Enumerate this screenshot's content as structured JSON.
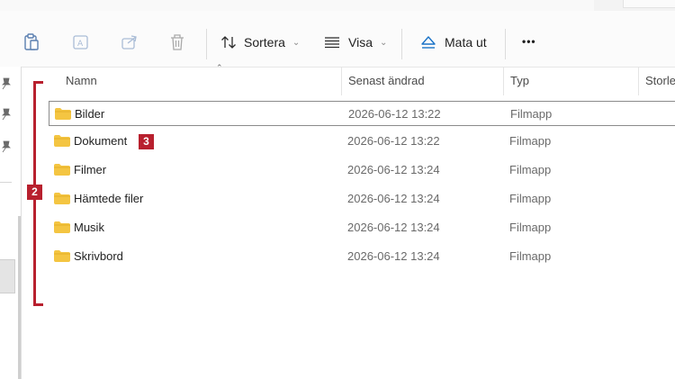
{
  "toolbar": {
    "sort_label": "Sortera",
    "view_label": "Visa",
    "eject_label": "Mata ut",
    "more_label": "•••"
  },
  "columns": {
    "name": "Namn",
    "modified": "Senast ändrad",
    "type": "Typ",
    "size": "Storle"
  },
  "files": [
    {
      "name": "Bilder",
      "modified": "2026-06-12 13:22",
      "type": "Filmapp"
    },
    {
      "name": "Dokument",
      "modified": "2026-06-12 13:22",
      "type": "Filmapp"
    },
    {
      "name": "Filmer",
      "modified": "2026-06-12 13:24",
      "type": "Filmapp"
    },
    {
      "name": "Hämtede filer",
      "modified": "2026-06-12 13:24",
      "type": "Filmapp"
    },
    {
      "name": "Musik",
      "modified": "2026-06-12 13:24",
      "type": "Filmapp"
    },
    {
      "name": "Skrivbord",
      "modified": "2026-06-12 13:24",
      "type": "Filmapp"
    }
  ],
  "annotations": {
    "badge_2": "2",
    "badge_3": "3"
  },
  "colors": {
    "annotation_red": "#b8202e",
    "folder_yellow": "#f4c542",
    "eject_blue": "#1a73c7"
  }
}
